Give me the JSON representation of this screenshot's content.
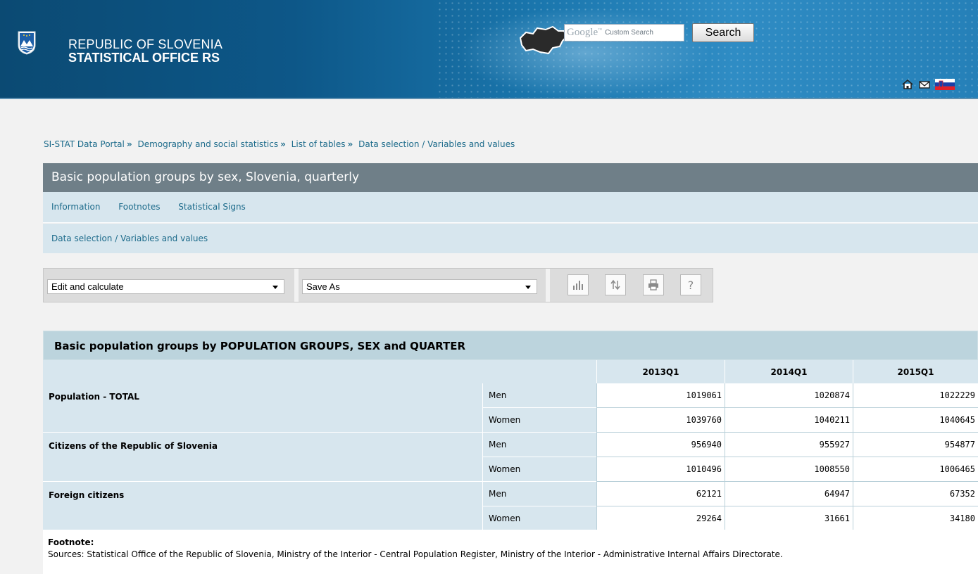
{
  "header": {
    "org_line1": "REPUBLIC OF SLOVENIA",
    "org_line2": "STATISTICAL OFFICE RS",
    "search_brand": "Google",
    "search_brand_tm": "™",
    "search_sub": "Custom Search",
    "search_button": "Search"
  },
  "breadcrumb": {
    "items": [
      "SI-STAT Data Portal",
      "Demography and social statistics",
      "List of tables",
      "Data selection / Variables and values"
    ],
    "separator": "»"
  },
  "page_title": "Basic population groups by sex, Slovenia, quarterly",
  "links": [
    "Information",
    "Footnotes",
    "Statistical Signs"
  ],
  "selection_link": "Data selection / Variables and values",
  "toolbar": {
    "edit_select": "Edit and calculate",
    "save_select": "Save As",
    "help_label": "?"
  },
  "table": {
    "title": "Basic population groups by POPULATION GROUPS, SEX and QUARTER",
    "columns": [
      "2013Q1",
      "2014Q1",
      "2015Q1"
    ],
    "groups": [
      {
        "name": "Population - TOTAL",
        "rows": [
          {
            "sex": "Men",
            "values": [
              "1019061",
              "1020874",
              "1022229"
            ]
          },
          {
            "sex": "Women",
            "values": [
              "1039760",
              "1040211",
              "1040645"
            ]
          }
        ]
      },
      {
        "name": "Citizens of the Republic of Slovenia",
        "rows": [
          {
            "sex": "Men",
            "values": [
              "956940",
              "955927",
              "954877"
            ]
          },
          {
            "sex": "Women",
            "values": [
              "1010496",
              "1008550",
              "1006465"
            ]
          }
        ]
      },
      {
        "name": "Foreign citizens",
        "rows": [
          {
            "sex": "Men",
            "values": [
              "62121",
              "64947",
              "67352"
            ]
          },
          {
            "sex": "Women",
            "values": [
              "29264",
              "31661",
              "34180"
            ]
          }
        ]
      }
    ]
  },
  "footnote": {
    "heading": "Footnote:",
    "text": "Sources: Statistical Office of the Republic of Slovenia, Ministry of the Interior - Central Population Register, Ministry of the Interior - Administrative Internal Affairs Directorate."
  },
  "colors": {
    "header_blue": "#0d5788",
    "title_bar": "#6f7f88",
    "light_panel": "#d7e6ee",
    "table_title": "#bcd4dd",
    "link": "#1b6a8a"
  },
  "icons": [
    "crest-icon",
    "slovenia-map-icon",
    "home-icon",
    "mail-icon",
    "slovenian-flag-icon",
    "chart-icon",
    "pivot-icon",
    "print-icon",
    "help-icon"
  ]
}
